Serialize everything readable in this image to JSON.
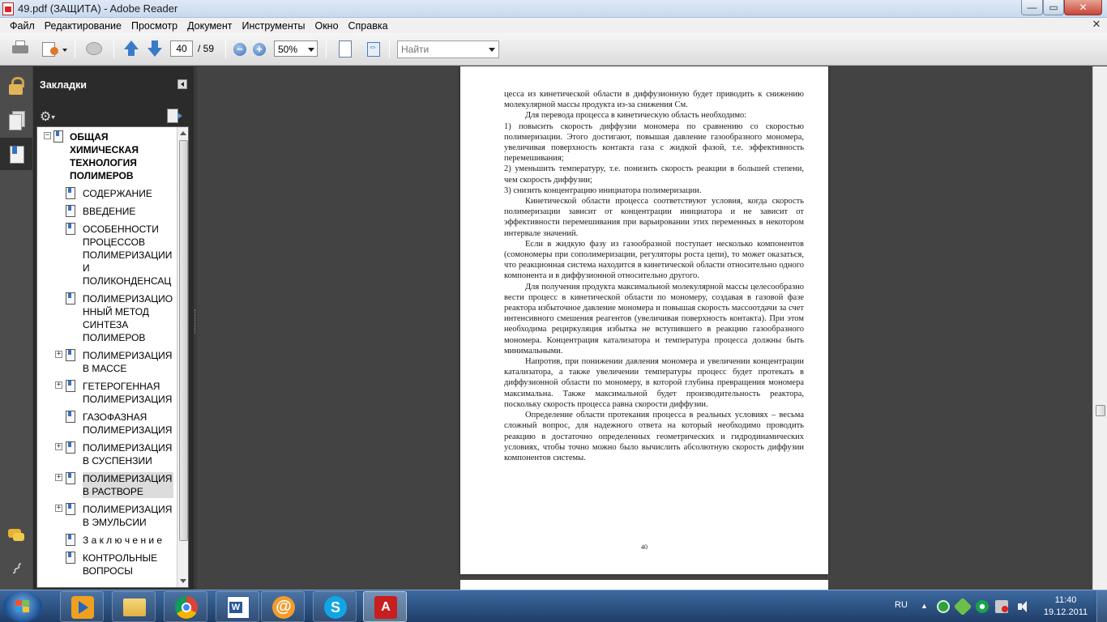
{
  "window": {
    "title": "49.pdf (ЗАЩИТА) - Adobe Reader",
    "minimize": "—",
    "maximize": "▭",
    "close": "✕"
  },
  "menu": {
    "items": [
      "Файл",
      "Редактирование",
      "Просмотр",
      "Документ",
      "Инструменты",
      "Окно",
      "Справка"
    ],
    "close_glyph": "✕"
  },
  "toolbar": {
    "current_page": "40",
    "total_pages": "/ 59",
    "zoom_out_glyph": "−",
    "zoom_in_glyph": "+",
    "zoom": "50%",
    "search_placeholder": "Найти"
  },
  "bookmarks": {
    "title": "Закладки",
    "options_glyph": "⚙",
    "options_dd": "▾",
    "items": [
      {
        "label": "ОБЩАЯ\nХИМИЧЕСКАЯ\nТЕХНОЛОГИЯ\nПОЛИМЕРОВ",
        "toggle": "−",
        "level": 0
      },
      {
        "label": "СОДЕРЖАНИЕ",
        "toggle": "",
        "level": 1
      },
      {
        "label": "ВВЕДЕНИЕ",
        "toggle": "",
        "level": 1
      },
      {
        "label": "ОСОБЕННОСТИ\nПРОЦЕССОВ\nПОЛИМЕРИЗАЦИИ\nИ\nПОЛИКОНДЕНСАЦ",
        "toggle": "",
        "level": 1
      },
      {
        "label": "ПОЛИМЕРИЗАЦИО\nННЫЙ МЕТОД\nСИНТЕЗА\nПОЛИМЕРОВ",
        "toggle": "",
        "level": 1
      },
      {
        "label": "ПОЛИМЕРИЗАЦИЯ\nВ МАССЕ",
        "toggle": "+",
        "level": 1
      },
      {
        "label": "ГЕТЕРОГЕННАЯ\nПОЛИМЕРИЗАЦИЯ",
        "toggle": "+",
        "level": 1
      },
      {
        "label": "ГАЗОФАЗНАЯ\nПОЛИМЕРИЗАЦИЯ",
        "toggle": "",
        "level": 1
      },
      {
        "label": "ПОЛИМЕРИЗАЦИЯ\nВ СУСПЕНЗИИ",
        "toggle": "+",
        "level": 1
      },
      {
        "label": "ПОЛИМЕРИЗАЦИЯ\nВ РАСТВОРЕ",
        "toggle": "+",
        "level": 1,
        "selected": true
      },
      {
        "label": "ПОЛИМЕРИЗАЦИЯ\nВ ЭМУЛЬСИИ",
        "toggle": "+",
        "level": 1
      },
      {
        "label": "З а к л ю ч е н и е",
        "toggle": "",
        "level": 1
      },
      {
        "label": "КОНТРОЛЬНЫЕ\nВОПРОСЫ",
        "toggle": "",
        "level": 1
      }
    ]
  },
  "page": {
    "number": "40",
    "paragraphs": [
      {
        "indent": false,
        "text": "цесса из кинетической области в диффузионную будет приводить к снижению молекулярной массы продукта из-за снижения Cм."
      },
      {
        "indent": true,
        "text": "Для перевода процесса в кинетическую область необходимо:"
      },
      {
        "indent": false,
        "text": "1) повысить скорость диффузии мономера по сравнению со скоростью полимеризации. Этого достигают, повышая давление газообразного мономера, увеличивая поверхность контакта газа с жидкой фазой, т.е. эффективность перемешивания;"
      },
      {
        "indent": false,
        "text": "2) уменьшить температуру, т.е. понизить скорость реакции в большей степени, чем скорость диффузии;"
      },
      {
        "indent": false,
        "text": "3) снизить концентрацию инициатора полимеризации."
      },
      {
        "indent": true,
        "text": "Кинетической области процесса соответствуют условия, когда скорость полимеризации зависит от концентрации инициатора и не зависит от эффективности перемешивания при варьировании этих переменных в некотором интервале значений."
      },
      {
        "indent": true,
        "text": "Если в жидкую фазу из газообразной поступает несколько компонентов (сомономеры при сополимеризации, регуляторы роста цепи), то может оказаться, что реакционная система находится в кинетической области относительно одного компонента и в диффузионной относительно другого."
      },
      {
        "indent": true,
        "text": "Для получения продукта максимальной молекулярной массы целесообразно вести процесс в кинетической области по мономеру, создавая в газовой фазе реактора избыточное давление мономера и повышая скорость массоотдачи за счет интенсивного смешения реагентов (увеличивая поверхность контакта). При этом необходима рециркуляция избытка не вступившего в реакцию газообразного мономера. Концентрация катализатора и температура процесса должны быть минимальными."
      },
      {
        "indent": true,
        "text": "Напротив, при понижении давления мономера и увеличении концентрации катализатора, а также увеличении температуры процесс будет протекать в диффузионной области по мономеру, в которой глубина превращения мономера максимальна. Также максимальной будет производительность реактора, поскольку скорость процесса равна скорости диффузии."
      },
      {
        "indent": true,
        "text": "Определение области протекания процесса в реальных условиях – весьма сложный вопрос, для надежного ответа на который необходимо проводить реакцию в достаточно определенных геометрических и гидродинамических условиях, чтобы точно можно было вычислить абсолютную скорость диффузии компонентов системы."
      }
    ]
  },
  "taskbar": {
    "language": "RU",
    "tray_expand": "▲",
    "time": "11:40",
    "date": "19.12.2011"
  },
  "colors": {
    "accent_blue": "#3a7bc8",
    "acrobat_red": "#c81e1e",
    "panel_dark": "#2b2b2b",
    "doc_bg": "#434343"
  }
}
